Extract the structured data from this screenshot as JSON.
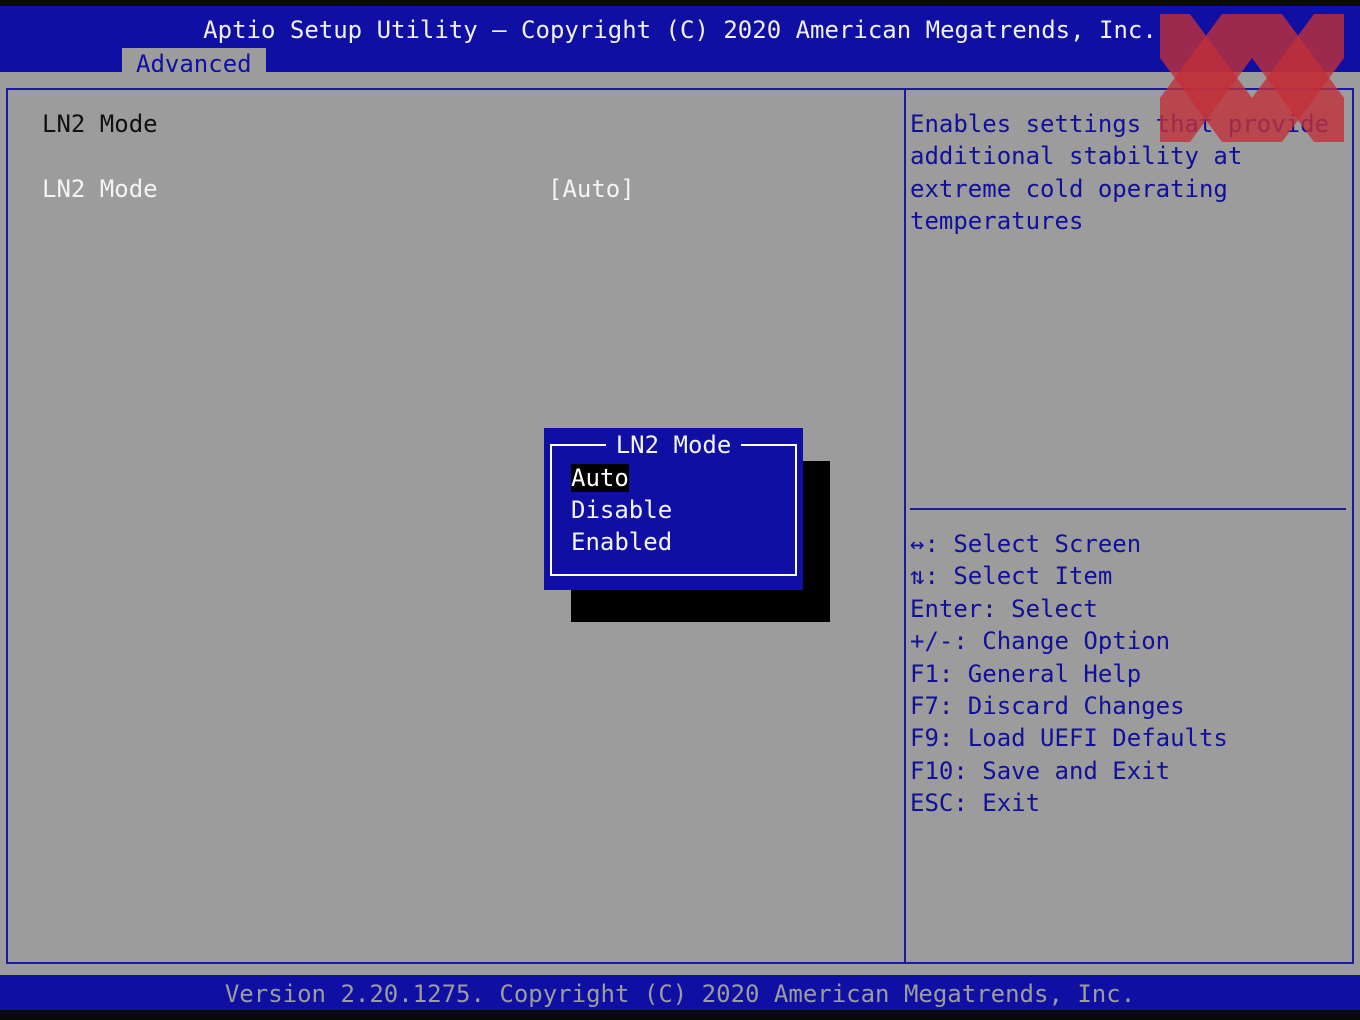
{
  "header": {
    "title": "Aptio Setup Utility – Copyright (C) 2020 American Megatrends, Inc.",
    "tabs": [
      {
        "label": "Advanced",
        "active": true
      }
    ]
  },
  "main": {
    "section_title": "LN2 Mode",
    "settings": [
      {
        "label": "LN2 Mode",
        "value": "[Auto]"
      }
    ]
  },
  "help": {
    "description_lines": [
      "Enables settings that provide",
      "additional stability at",
      "extreme cold operating",
      "temperatures"
    ],
    "keys": [
      "↔: Select Screen",
      "⇅: Select Item",
      "Enter: Select",
      "+/-: Change Option",
      "F1: General Help",
      "F7: Discard Changes",
      "F9: Load UEFI Defaults",
      "F10: Save and Exit",
      "ESC: Exit"
    ]
  },
  "popup": {
    "title": "LN2 Mode",
    "options": [
      "Auto",
      "Disable",
      "Enabled"
    ],
    "selected": "Auto"
  },
  "footer": {
    "text": "Version 2.20.1275. Copyright (C) 2020 American Megatrends, Inc."
  },
  "colors": {
    "bios_blue": "#0f0fa3",
    "panel_gray": "#9c9c9c",
    "logo_red": "#c0303a"
  },
  "logo": {
    "icon": "xx-watermark-logo"
  }
}
